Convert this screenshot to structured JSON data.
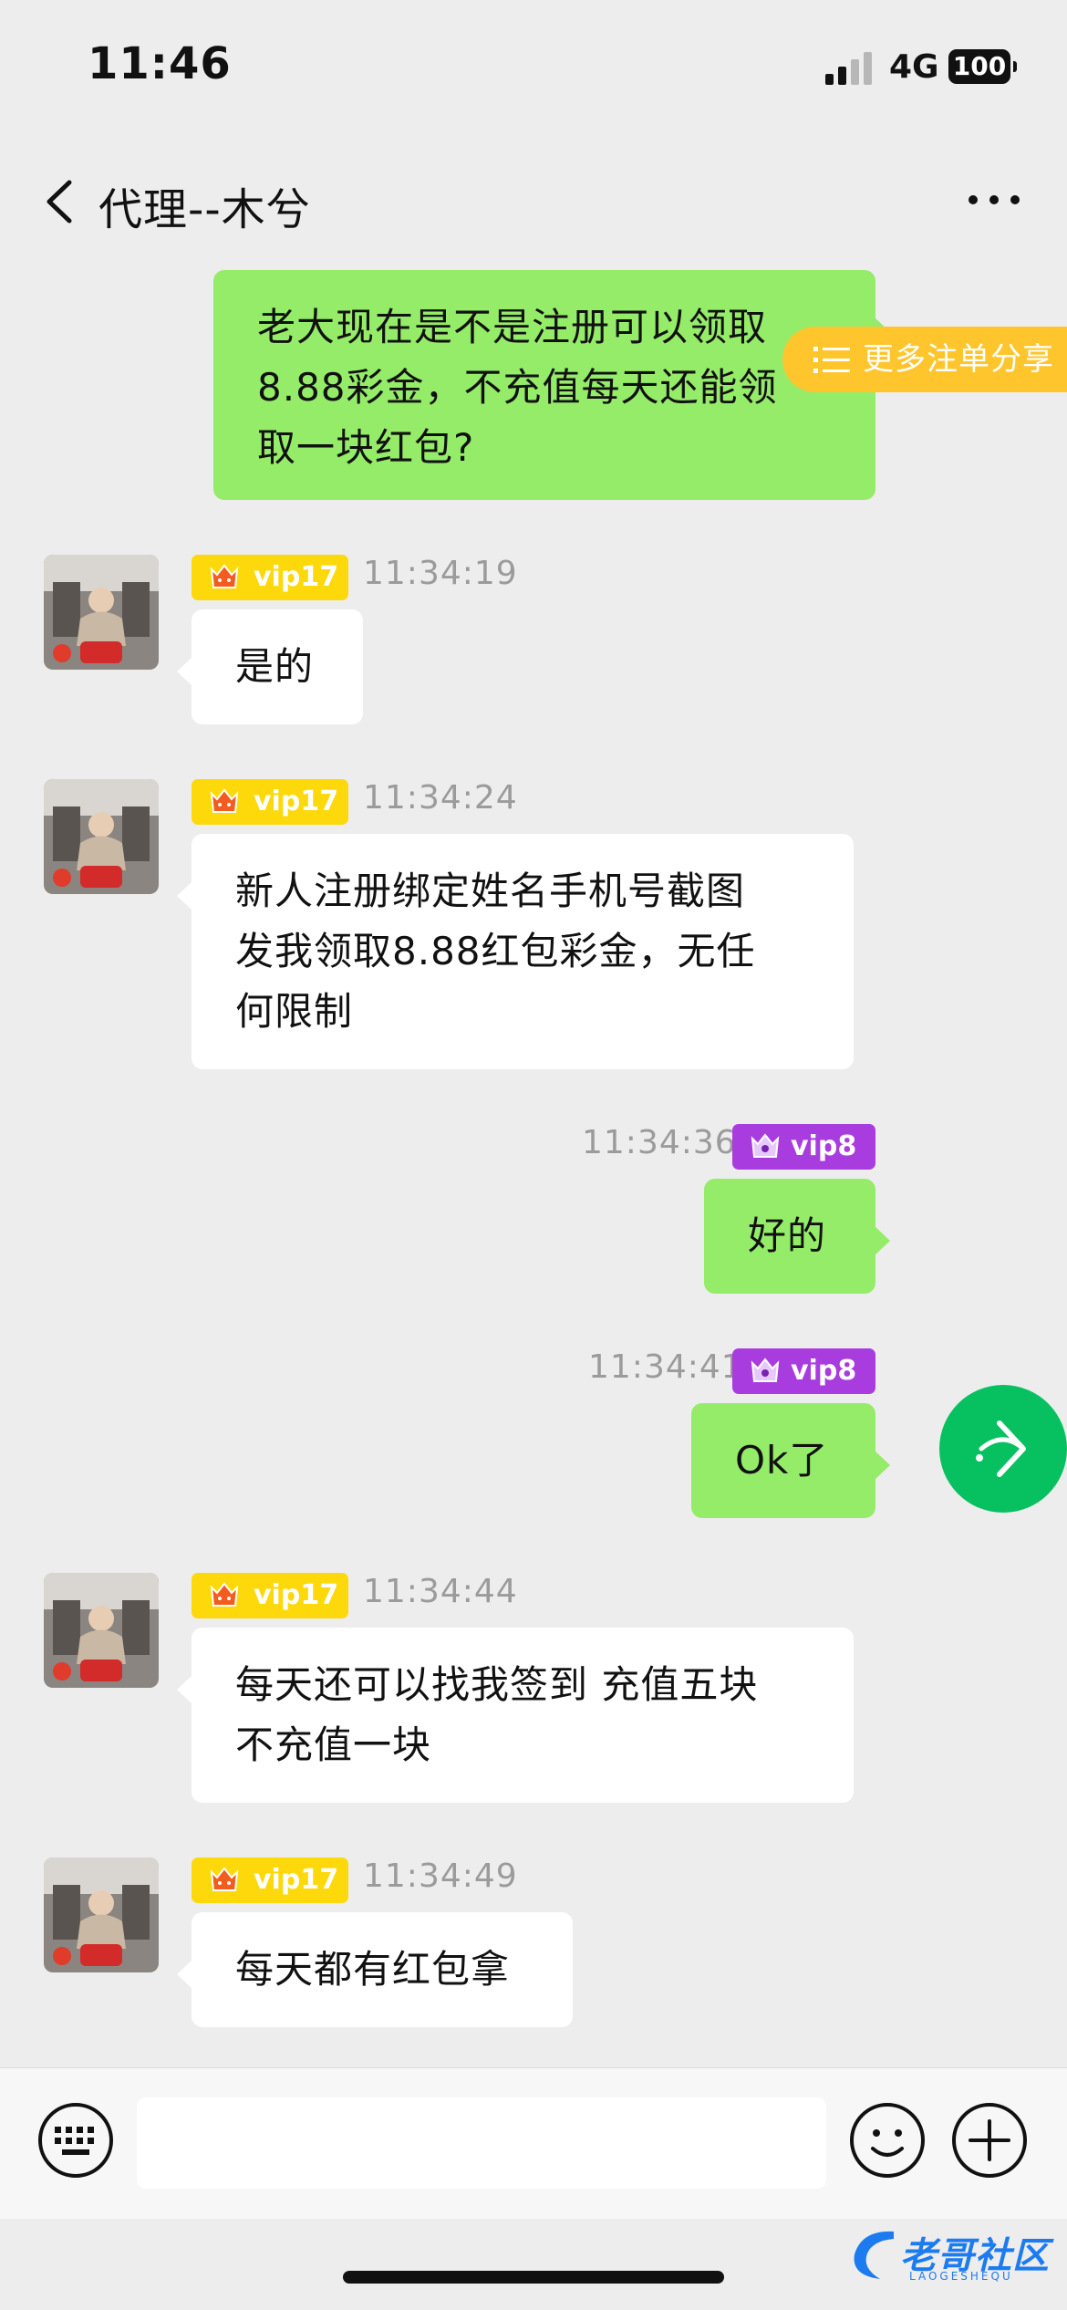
{
  "status_bar": {
    "time": "11:46",
    "network": "4G",
    "battery": "100"
  },
  "nav": {
    "title": "代理--木兮"
  },
  "floating": {
    "share_label": "更多注单分享"
  },
  "messages": [
    {
      "side": "out",
      "lines": [
        "老大现在是不是注册可以领取",
        "8.88彩金，不充值每天还能领",
        "取一块红包?"
      ]
    },
    {
      "side": "in",
      "badge": "vip17",
      "time": "11:34:19",
      "lines": [
        "是的"
      ]
    },
    {
      "side": "in",
      "badge": "vip17",
      "time": "11:34:24",
      "lines": [
        "新人注册绑定姓名手机号截图",
        "发我领取8.88红包彩金，无任",
        "何限制"
      ]
    },
    {
      "side": "out",
      "badge": "vip8",
      "time": "11:34:36",
      "lines": [
        "好的"
      ]
    },
    {
      "side": "out",
      "badge": "vip8",
      "time": "11:34:41",
      "lines": [
        "Ok了"
      ]
    },
    {
      "side": "in",
      "badge": "vip17",
      "time": "11:34:44",
      "lines": [
        "每天还可以找我签到 充值五块",
        "不充值一块"
      ]
    },
    {
      "side": "in",
      "badge": "vip17",
      "time": "11:34:49",
      "lines": [
        "每天都有红包拿"
      ]
    }
  ],
  "input": {
    "placeholder": "",
    "value": ""
  },
  "watermark": {
    "text": "老哥社区",
    "sub": "LAOGESHEQU"
  },
  "colors": {
    "outgoing_bubble": "#95ec69",
    "incoming_bubble": "#ffffff",
    "vip17_badge": "#fdd90b",
    "vip8_badge": "#a93cdf",
    "share_pill": "#ffc52d",
    "fab": "#07c160",
    "background": "#ededed"
  },
  "icons": {
    "back": "chevron-left-icon",
    "more": "ellipsis-icon",
    "keyboard": "keyboard-icon",
    "emoji": "smiley-icon",
    "plus": "plus-circle-icon",
    "fab": "forward-arrow-icon",
    "share": "list-icon",
    "badge_gold": "crown-tiger-icon",
    "badge_purple": "crown-dragon-icon"
  }
}
